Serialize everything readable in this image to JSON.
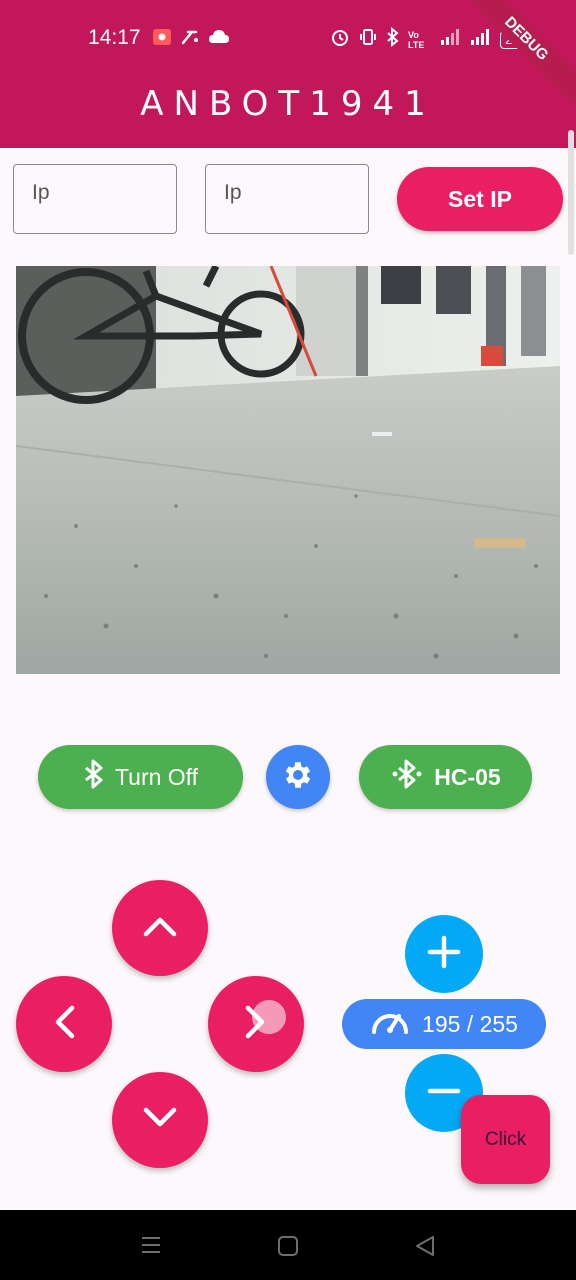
{
  "status_bar": {
    "time": "14:17",
    "battery": "28",
    "network": "Vo LTE"
  },
  "app_bar": {
    "title": "ANBOT1941",
    "debug_banner": "DEBUG"
  },
  "ip_row": {
    "ip1_placeholder": "Ip",
    "ip2_placeholder": "Ip",
    "set_ip_label": "Set IP"
  },
  "bluetooth_row": {
    "turn_off_label": "Turn Off",
    "device_label": "HC-05"
  },
  "speed": {
    "value": 195,
    "max": 255,
    "display": "195 / 255"
  },
  "fab": {
    "label": "Click"
  },
  "colors": {
    "primary": "#c2185b",
    "accent": "#e91e63",
    "green": "#4caf50",
    "blue": "#4285f4",
    "light_blue": "#03a9f4"
  }
}
